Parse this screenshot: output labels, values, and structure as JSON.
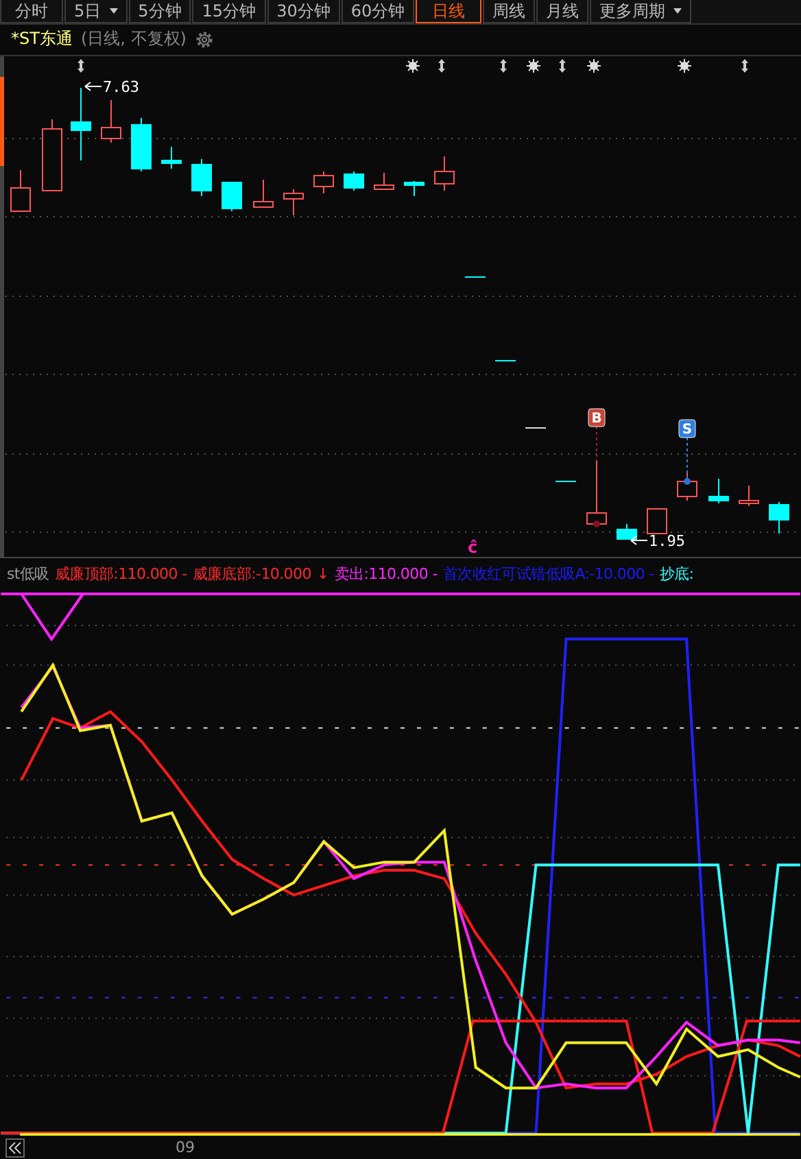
{
  "tabs": [
    {
      "label": "分时",
      "selected": false,
      "dropdown": false
    },
    {
      "label": "5日",
      "selected": false,
      "dropdown": true
    },
    {
      "label": "5分钟",
      "selected": false,
      "dropdown": false
    },
    {
      "label": "15分钟",
      "selected": false,
      "dropdown": false
    },
    {
      "label": "30分钟",
      "selected": false,
      "dropdown": false
    },
    {
      "label": "60分钟",
      "selected": false,
      "dropdown": false
    },
    {
      "label": "日线",
      "selected": true,
      "dropdown": false
    },
    {
      "label": "周线",
      "selected": false,
      "dropdown": false
    },
    {
      "label": "月线",
      "selected": false,
      "dropdown": false
    },
    {
      "label": "更多周期",
      "selected": false,
      "dropdown": true
    }
  ],
  "title": {
    "name": "*ST东通",
    "subtitle": "(日线, 不复权)"
  },
  "price_chart": {
    "high_label": "7.63",
    "low_label": "1.95",
    "signals": [
      {
        "text": "B",
        "kind": "buy"
      },
      {
        "text": "S",
        "kind": "sell"
      }
    ],
    "mark": "ĉ"
  },
  "indicator": {
    "name": "st低吸",
    "legend": [
      {
        "label": "威廉顶部:110.000 -",
        "color": "#ff2a2a"
      },
      {
        "label": "威廉底部:-10.000",
        "color": "#ff2a2a"
      },
      {
        "label": "↓",
        "color": "#ff2a2a"
      },
      {
        "label": "卖出:110.000 -",
        "color": "#ff2aff"
      },
      {
        "label": "首次收红可试错低吸A:-10.000 -",
        "color": "#1a1aff"
      },
      {
        "label": "抄底:",
        "color": "#33ffff"
      }
    ]
  },
  "axis": {
    "label": "09"
  }
}
